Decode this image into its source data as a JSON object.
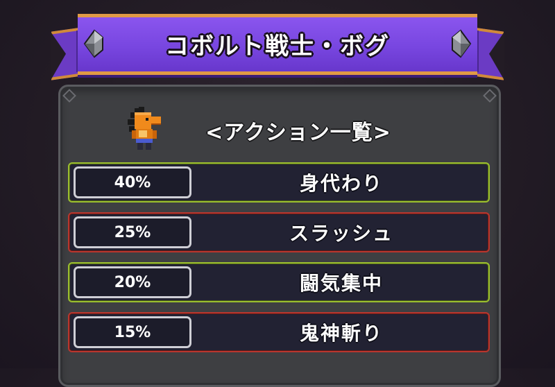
{
  "banner": {
    "title": "コボルト戦士・ボグ"
  },
  "header": {
    "title": "<アクション一覧>",
    "icon": "kobold-warrior-icon"
  },
  "actions": [
    {
      "rate": "40%",
      "name": "身代わり",
      "color": "green"
    },
    {
      "rate": "25%",
      "name": "スラッシュ",
      "color": "red"
    },
    {
      "rate": "20%",
      "name": "闘気集中",
      "color": "green"
    },
    {
      "rate": "15%",
      "name": "鬼神斬り",
      "color": "red"
    }
  ],
  "colors": {
    "banner": "#7846e0",
    "banner_trim": "#e09a45",
    "green_border": "#9bbf2f",
    "red_border": "#b9362e",
    "panel": "#3e3f42"
  }
}
